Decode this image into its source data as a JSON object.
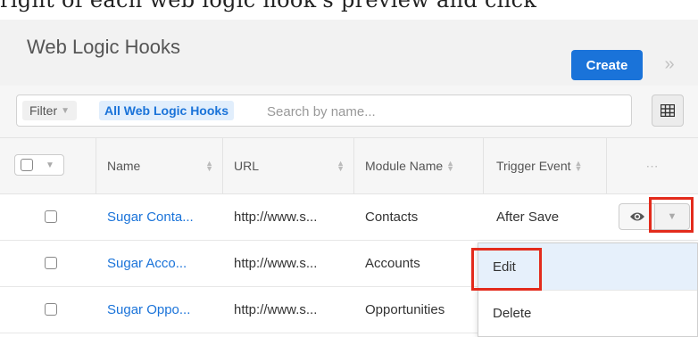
{
  "caption": "right of each web logic hook's preview and click",
  "header": {
    "title": "Web Logic Hooks",
    "create_label": "Create"
  },
  "filter": {
    "label": "Filter",
    "chip": "All Web Logic Hooks",
    "search_placeholder": "Search by name..."
  },
  "table": {
    "columns": [
      "Name",
      "URL",
      "Module Name",
      "Trigger Event"
    ],
    "actions_header": "⋯",
    "rows": [
      {
        "name": "Sugar Conta...",
        "url": "http://www.s...",
        "module": "Contacts",
        "trigger": "After Save"
      },
      {
        "name": "Sugar Acco...",
        "url": "http://www.s...",
        "module": "Accounts",
        "trigger": ""
      },
      {
        "name": "Sugar Oppo...",
        "url": "http://www.s...",
        "module": "Opportunities",
        "trigger": ""
      }
    ]
  },
  "row_actions_menu": {
    "edit_label": "Edit",
    "delete_label": "Delete"
  },
  "colors": {
    "accent": "#1a73d9",
    "highlight": "#e32b1c"
  },
  "icons": [
    "chevron-double-right-icon",
    "grid-icon",
    "eye-icon",
    "caret-down-icon",
    "sort-icon"
  ]
}
